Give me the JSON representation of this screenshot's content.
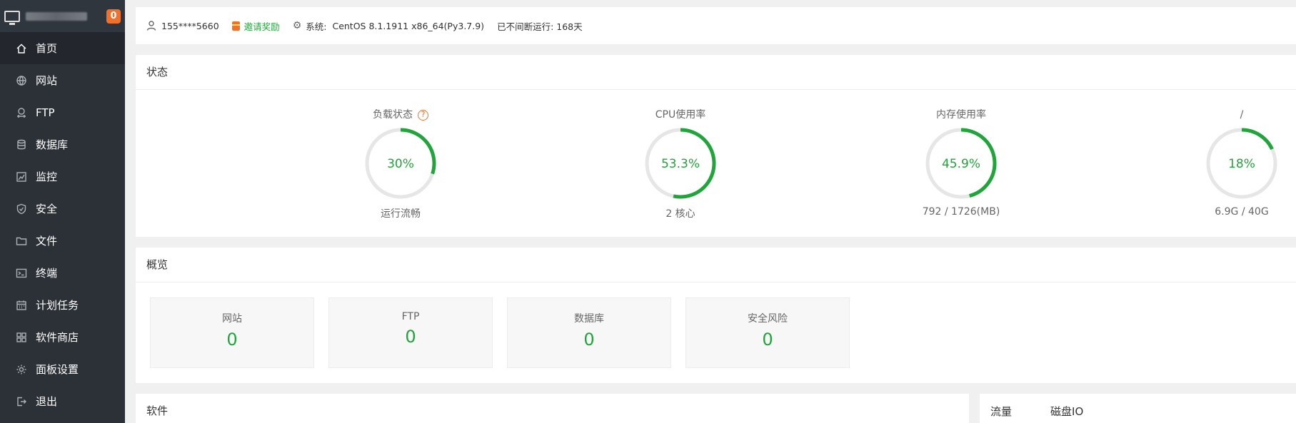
{
  "sidebar": {
    "badge": "0",
    "items": [
      {
        "label": "首页",
        "icon": "home-icon"
      },
      {
        "label": "网站",
        "icon": "globe-icon"
      },
      {
        "label": "FTP",
        "icon": "ftp-icon"
      },
      {
        "label": "数据库",
        "icon": "database-icon"
      },
      {
        "label": "监控",
        "icon": "monitor-chart-icon"
      },
      {
        "label": "安全",
        "icon": "shield-icon"
      },
      {
        "label": "文件",
        "icon": "folder-icon"
      },
      {
        "label": "终端",
        "icon": "terminal-icon"
      },
      {
        "label": "计划任务",
        "icon": "calendar-icon"
      },
      {
        "label": "软件商店",
        "icon": "grid-icon"
      },
      {
        "label": "面板设置",
        "icon": "gear-icon"
      },
      {
        "label": "退出",
        "icon": "logout-icon"
      }
    ]
  },
  "topbar": {
    "user": "155****5660",
    "invite": "邀请奖励",
    "system_label": "系统:",
    "system_value": "CentOS 8.1.1911 x86_64(Py3.7.9)",
    "uptime": "已不间断运行: 168天"
  },
  "status": {
    "title": "状态",
    "gauges": [
      {
        "title": "负载状态",
        "value": "30%",
        "percent": 30,
        "sub": "运行流畅",
        "help": "?"
      },
      {
        "title": "CPU使用率",
        "value": "53.3%",
        "percent": 53.3,
        "sub": "2 核心"
      },
      {
        "title": "内存使用率",
        "value": "45.9%",
        "percent": 45.9,
        "sub": "792 / 1726(MB)"
      },
      {
        "title": "/",
        "value": "18%",
        "percent": 18,
        "sub": "6.9G / 40G"
      }
    ]
  },
  "overview": {
    "title": "概览",
    "cards": [
      {
        "label": "网站",
        "value": "0"
      },
      {
        "label": "FTP",
        "value": "0"
      },
      {
        "label": "数据库",
        "value": "0"
      },
      {
        "label": "安全风险",
        "value": "0"
      }
    ]
  },
  "software": {
    "title": "软件"
  },
  "traffic": {
    "tabs": [
      "流量",
      "磁盘IO"
    ]
  },
  "colors": {
    "accent": "#20a53a",
    "sidebar_bg": "#2c3138",
    "badge": "#f0712c",
    "ring_track": "#e6e6e6"
  }
}
